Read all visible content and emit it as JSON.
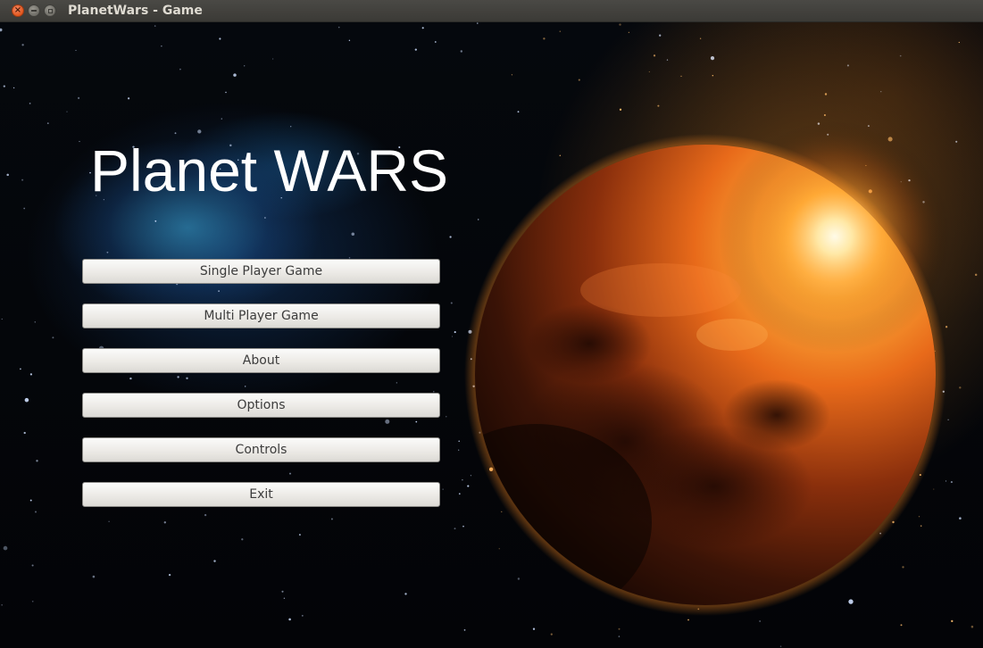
{
  "window": {
    "title": "PlanetWars - Game",
    "controls": [
      "close-icon",
      "minimize-icon",
      "maximize-icon"
    ]
  },
  "game": {
    "title": "Planet WARS"
  },
  "menu": {
    "items": [
      {
        "id": "single-player",
        "label": "Single Player Game"
      },
      {
        "id": "multi-player",
        "label": "Multi Player Game"
      },
      {
        "id": "about",
        "label": "About"
      },
      {
        "id": "options",
        "label": "Options"
      },
      {
        "id": "controls",
        "label": "Controls"
      },
      {
        "id": "exit",
        "label": "Exit"
      }
    ]
  },
  "colors": {
    "titlebar": "#3c3b37",
    "close": "#e2561c",
    "planet_glow": "#ff9a2a",
    "nebula": "#3aa8dc",
    "button_face": "#eceae6"
  }
}
